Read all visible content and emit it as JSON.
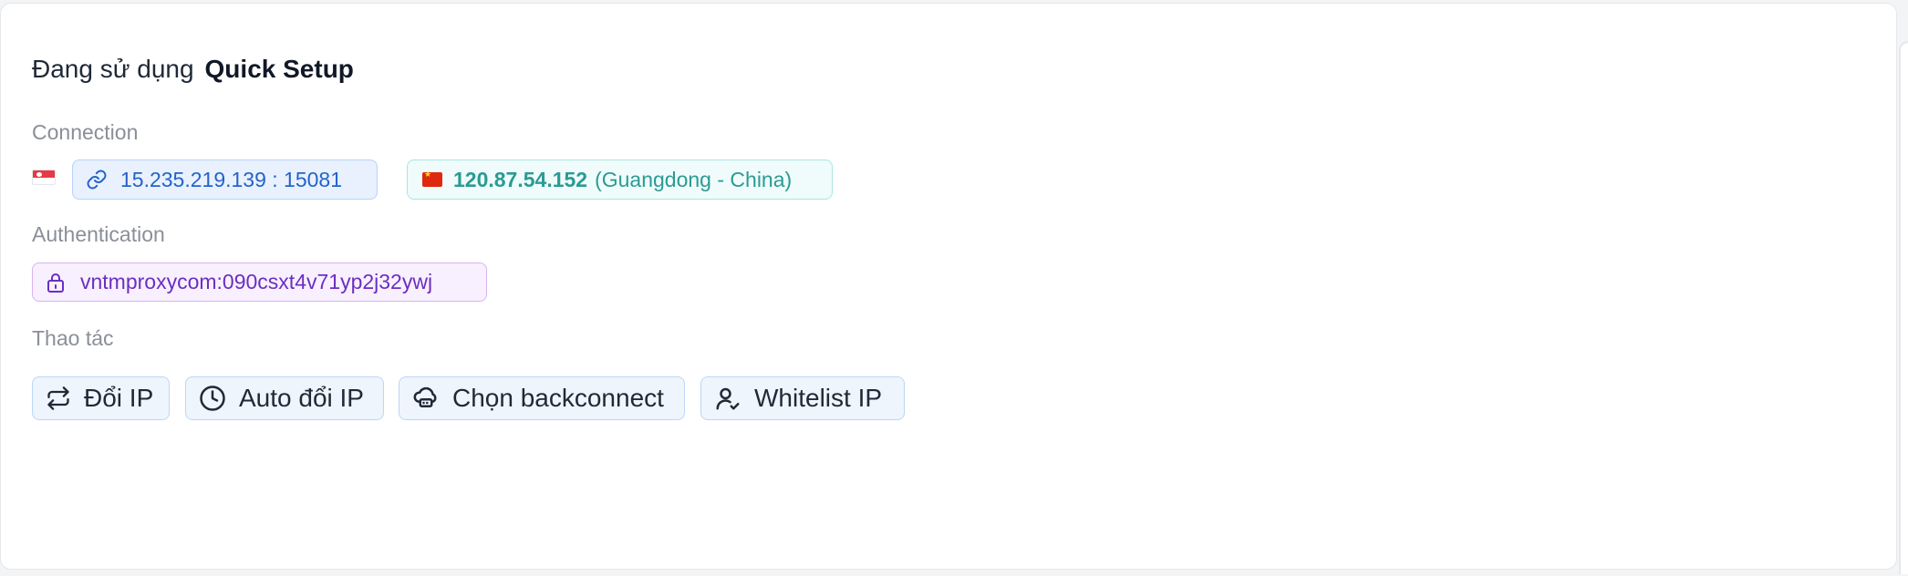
{
  "header": {
    "prefix": "Đang sử dụng",
    "package_name": "Quick Setup"
  },
  "connection": {
    "label": "Connection",
    "proxy_flag": "singapore-flag-icon",
    "proxy_address": "15.235.219.139 : 15081",
    "exit_flag": "china-flag-icon",
    "exit_ip": "120.87.54.152",
    "exit_location": "(Guangdong - China)"
  },
  "authentication": {
    "label": "Authentication",
    "credentials": "vntmproxycom:090csxt4v71yp2j32ywj"
  },
  "actions": {
    "label": "Thao tác",
    "buttons": [
      {
        "label": "Đổi IP",
        "icon": "swap-icon"
      },
      {
        "label": "Auto đổi IP",
        "icon": "clock-icon"
      },
      {
        "label": "Chọn backconnect",
        "icon": "cloud-router-icon"
      },
      {
        "label": "Whitelist IP",
        "icon": "user-check-icon"
      }
    ]
  },
  "colors": {
    "connection_chip": "#2563c9",
    "ip_chip": "#2b9a94",
    "auth_chip": "#6b2fbf",
    "button_bg": "#eff5fd"
  }
}
